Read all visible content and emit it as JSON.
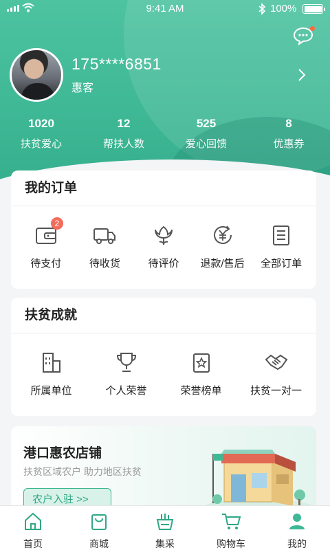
{
  "status_bar": {
    "time": "9:41 AM",
    "battery": "100%"
  },
  "profile": {
    "phone": "175****6851",
    "role": "惠客"
  },
  "stats": [
    {
      "value": "1020",
      "label": "扶贫爱心"
    },
    {
      "value": "12",
      "label": "帮扶人数"
    },
    {
      "value": "525",
      "label": "爱心回馈"
    },
    {
      "value": "8",
      "label": "优惠券"
    }
  ],
  "orders": {
    "title": "我的订单",
    "items": [
      {
        "label": "待支付",
        "icon": "wallet-icon",
        "badge": "2"
      },
      {
        "label": "待收货",
        "icon": "truck-icon"
      },
      {
        "label": "待评价",
        "icon": "flower-icon"
      },
      {
        "label": "退款/售后",
        "icon": "yen-refund-icon"
      },
      {
        "label": "全部订单",
        "icon": "list-icon"
      }
    ]
  },
  "achievements": {
    "title": "扶贫成就",
    "items": [
      {
        "label": "所属单位",
        "icon": "building-icon"
      },
      {
        "label": "个人荣誉",
        "icon": "trophy-icon"
      },
      {
        "label": "荣誉榜单",
        "icon": "star-board-icon"
      },
      {
        "label": "扶贫一对一",
        "icon": "handshake-icon"
      }
    ]
  },
  "promo": {
    "title": "港口惠农店铺",
    "subtitle": "扶贫区域农户   助力地区扶贫",
    "button": "农户入驻 >>"
  },
  "tabbar": {
    "active": "我的",
    "items": [
      {
        "label": "首页",
        "icon": "home-icon"
      },
      {
        "label": "商城",
        "icon": "shopping-bag-icon"
      },
      {
        "label": "集采",
        "icon": "basket-icon"
      },
      {
        "label": "购物车",
        "icon": "cart-icon"
      },
      {
        "label": "我的",
        "icon": "user-icon"
      }
    ]
  },
  "colors": {
    "primary": "#3fb896",
    "badge": "#f26b5b",
    "icon": "#555555"
  }
}
